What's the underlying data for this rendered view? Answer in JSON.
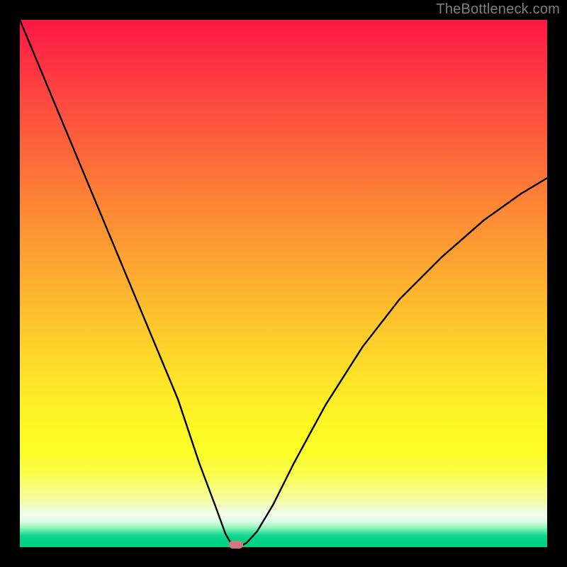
{
  "watermark": "TheBottleneck.com",
  "chart_data": {
    "type": "line",
    "title": "",
    "xlabel": "",
    "ylabel": "",
    "xlim": [
      0,
      100
    ],
    "ylim": [
      0,
      100
    ],
    "marker": {
      "x": 41,
      "y": 0.5
    },
    "series": [
      {
        "name": "bottleneck-curve",
        "x": [
          0,
          5,
          10,
          15,
          20,
          25,
          30,
          34,
          37,
          39,
          40,
          41,
          42,
          43,
          45,
          48,
          52,
          58,
          65,
          72,
          80,
          88,
          95,
          100
        ],
        "values": [
          100,
          88,
          76,
          64,
          52,
          40,
          28,
          16,
          8,
          2.5,
          0.8,
          0.3,
          0.3,
          0.8,
          3,
          8,
          16,
          27,
          38,
          47,
          55,
          62,
          67,
          70
        ]
      }
    ],
    "gradient_stops": [
      {
        "pos": 0.0,
        "color": "#fd1744"
      },
      {
        "pos": 0.5,
        "color": "#fdad30"
      },
      {
        "pos": 0.8,
        "color": "#fcfd28"
      },
      {
        "pos": 0.93,
        "color": "#f2fdd8"
      },
      {
        "pos": 1.0,
        "color": "#00d084"
      }
    ]
  }
}
